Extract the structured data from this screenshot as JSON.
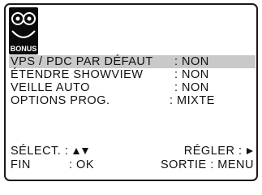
{
  "logo": {
    "label": "BONUS",
    "icon": "bonus-cassette-icon"
  },
  "menu": {
    "items": [
      {
        "label": "VPS / PDC PAR DÉFAUT",
        "value": ": NON",
        "selected": true
      },
      {
        "label": "ÉTENDRE SHOWVIEW",
        "value": ": NON",
        "selected": false
      },
      {
        "label": "VEILLE AUTO",
        "value": ": NON",
        "selected": false
      },
      {
        "label": "OPTIONS PROG.",
        "value": ": MIXTE",
        "selected": false
      }
    ]
  },
  "footer": {
    "select_label": "SÉLECT. :",
    "select_icons": "up-down-arrows-icon",
    "adjust_label": "RÉGLER :",
    "adjust_icon": "right-arrow-icon",
    "end_label": "FIN",
    "end_value": ": OK",
    "exit_label": "SORTIE : MENU"
  },
  "colors": {
    "highlight": "#c9c9c9",
    "logo_bg": "#0a0a0a",
    "text": "#111111"
  }
}
